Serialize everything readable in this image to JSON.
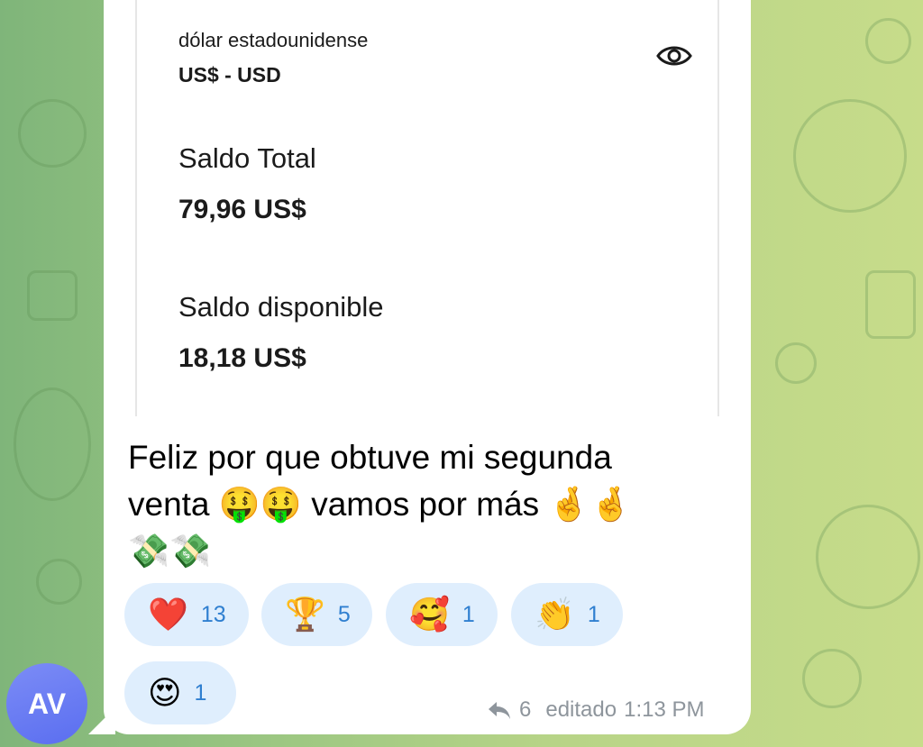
{
  "account": {
    "currency_name": "dólar estadounidense",
    "currency_code": "US$ - USD",
    "total_label": "Saldo Total",
    "total_value": "79,96 US$",
    "available_label": "Saldo disponible",
    "available_value": "18,18 US$",
    "visibility_icon": "eye-icon"
  },
  "message": {
    "text": "Feliz por que obtuve mi segunda venta 🤑🤑 vamos por más 🤞🤞 💸💸",
    "line1": "Feliz por que obtuve mi segunda",
    "line2": "venta 🤑🤑 vamos por más 🤞🤞",
    "line3": "💸💸"
  },
  "reactions": [
    {
      "emoji": "❤️",
      "count": "13"
    },
    {
      "emoji": "🏆",
      "count": "5"
    },
    {
      "emoji": "🥰",
      "count": "1"
    },
    {
      "emoji": "👏",
      "count": "1"
    },
    {
      "emoji": "😍",
      "count": "1"
    }
  ],
  "meta": {
    "reply_icon": "reply-arrow-icon",
    "replies": "6",
    "edited_label": "editado",
    "time": "1:13 PM"
  },
  "sender": {
    "initials": "AV",
    "avatar_color": "#6d7ff5"
  },
  "colors": {
    "reaction_bg": "#dfeefd",
    "reaction_count": "#2f7fd0",
    "meta_text": "#8e959c",
    "wallpaper_green": "#9cc782"
  }
}
